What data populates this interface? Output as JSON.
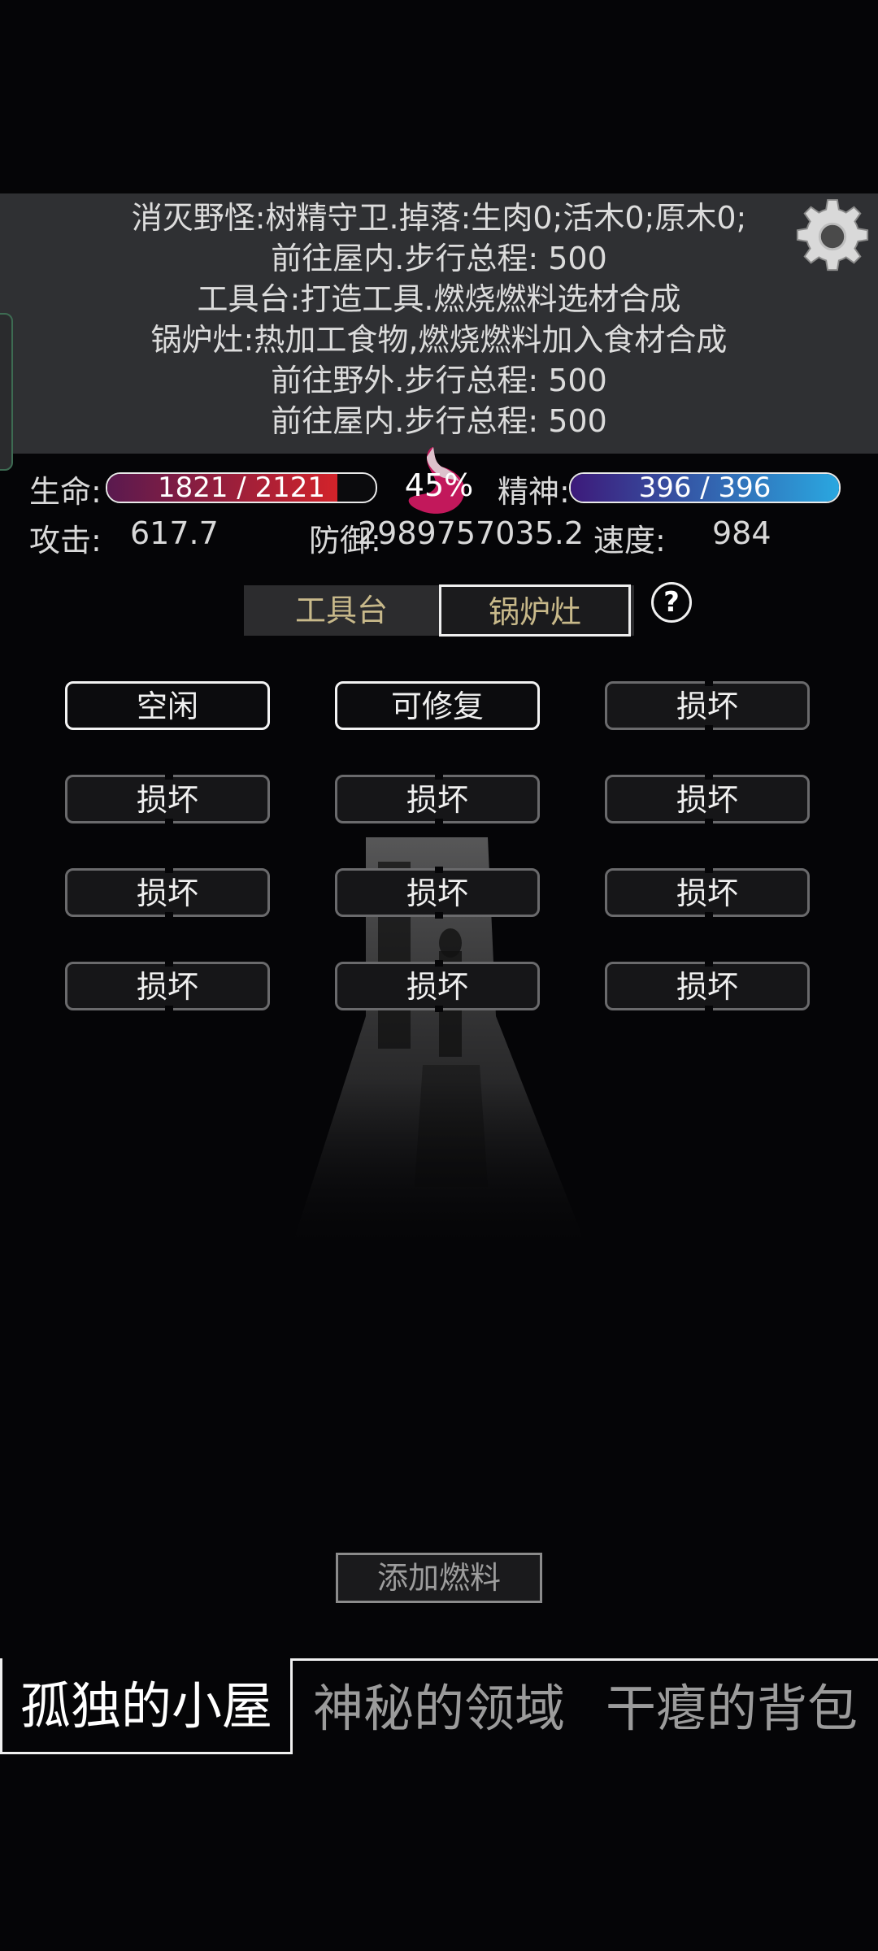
{
  "log": {
    "lines": [
      "消灭野怪:树精守卫.掉落:生肉0;活木0;原木0;",
      "前往屋内.步行总程: 500",
      "工具台:打造工具.燃烧燃料选材合成",
      "锅炉灶:热加工食物,燃烧燃料加入食材合成",
      "前往野外.步行总程: 500",
      "前往屋内.步行总程: 500"
    ]
  },
  "stats": {
    "hp_label": "生命:",
    "hp_text": "1821 / 2121",
    "hp_fraction": 0.858,
    "hunger_text": "45%",
    "spirit_label": "精神:",
    "spirit_text": "396 / 396",
    "spirit_fraction": 1.0,
    "attack_label": "攻击:",
    "attack_value": "617.7",
    "defense_label": "防御:",
    "defense_value": "2989757035.2",
    "speed_label": "速度:",
    "speed_value": "984"
  },
  "workshop_tabs": [
    {
      "label": "工具台",
      "active": false
    },
    {
      "label": "锅炉灶",
      "active": true
    }
  ],
  "help_label": "?",
  "slots": [
    "空闲",
    "可修复",
    "损坏",
    "损坏",
    "损坏",
    "损坏",
    "损坏",
    "损坏",
    "损坏",
    "损坏",
    "损坏",
    "损坏"
  ],
  "add_fuel_label": "添加燃料",
  "nav": [
    {
      "label": "孤独的小屋",
      "active": true
    },
    {
      "label": "神秘的领域",
      "active": false
    },
    {
      "label": "干瘪的背包",
      "active": false
    }
  ],
  "colors": {
    "hp_fill_start": "#5a1a4f",
    "hp_fill_end": "#d2232a",
    "spirit_fill_start": "#3d1a7a",
    "spirit_fill_end": "#2aa7e0",
    "log_bg": "#2f3033",
    "tab_text": "#c8b98a"
  }
}
